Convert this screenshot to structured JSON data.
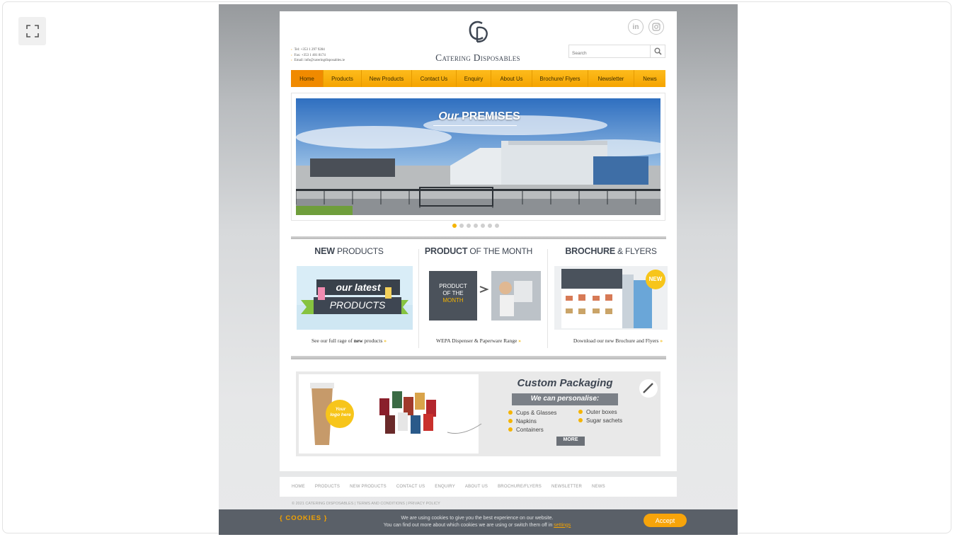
{
  "site": {
    "brand": "Catering Disposables",
    "contact_lines": [
      "Tel: +353 1 297 9284",
      "Fax: +353 1 401 8174",
      "Email: info@cateringdisposables.ie"
    ],
    "search_placeholder": "Search",
    "nav": [
      {
        "label": "Home",
        "active": true
      },
      {
        "label": "Products",
        "active": false
      },
      {
        "label": "New Products",
        "active": false
      },
      {
        "label": "Contact Us",
        "active": false
      },
      {
        "label": "Enquiry",
        "active": false
      },
      {
        "label": "About Us",
        "active": false
      },
      {
        "label": "Brochure/ Flyers",
        "active": false
      },
      {
        "label": "Newsletter",
        "active": false
      },
      {
        "label": "News",
        "active": false
      }
    ],
    "slider": {
      "title_script": "Our",
      "title_bold": "PREMISES",
      "slide_count": 7,
      "active_slide": 1
    },
    "columns": [
      {
        "title_bold": "NEW",
        "title_light": " PRODUCTS",
        "image_line1": "our latest",
        "image_line2": "PRODUCTS",
        "caption_pre": "See our full rage of ",
        "caption_bold": "new",
        "caption_post": " products",
        "arrow": "»"
      },
      {
        "title_bold": "PRODUCT",
        "title_light": " OF THE MONTH",
        "image_line1": "PRODUCT",
        "image_line2": "OF THE",
        "image_line3": "MONTH",
        "caption_pre": "WEPA Dispenser & Paperware Range",
        "caption_bold": "",
        "caption_post": "",
        "arrow": "»"
      },
      {
        "title_bold": "BROCHURE",
        "title_light": " & FLYERS",
        "image_badge": "NEW",
        "caption_pre": "Download our new Brochure and Flyers",
        "caption_bold": "",
        "caption_post": "",
        "arrow": "»"
      }
    ],
    "banner": {
      "title": "Custom Packaging",
      "subtitle": "We can personalise:",
      "logo_badge_line1": "Your",
      "logo_badge_line2": "logo here",
      "items_left": [
        "Cups & Glasses",
        "Napkins",
        "Containers"
      ],
      "items_right": [
        "Outer boxes",
        "Sugar sachets"
      ],
      "more": "MORE"
    },
    "footer_links": [
      "HOME",
      "PRODUCTS",
      "NEW PRODUCTS",
      "CONTACT US",
      "ENQUIRY",
      "ABOUT US",
      "BROCHURE/FLYERS",
      "NEWSLETTER",
      "NEWS"
    ],
    "copyright": "© 2021 CATERING DISPOSABLES | TERMS AND CONDITIONS | PRIVACY POLICY",
    "cookies": {
      "label": "{ COOKIES }",
      "line1": "We are using cookies to give you the best experience on our website.",
      "line2": "You can find out more about which cookies we are using or switch them off in ",
      "link": "settings",
      "accept": "Accept"
    }
  },
  "colors": {
    "accent_orange": "#f5a400",
    "nav_active": "#f08a00",
    "text_dark": "#3e4652",
    "cookie_bg": "#5a6068"
  },
  "icons": {
    "expand": "expand-icon",
    "linkedin": "linkedin-icon",
    "instagram": "instagram-icon",
    "search": "search-icon",
    "brush": "paint-brush-icon"
  }
}
